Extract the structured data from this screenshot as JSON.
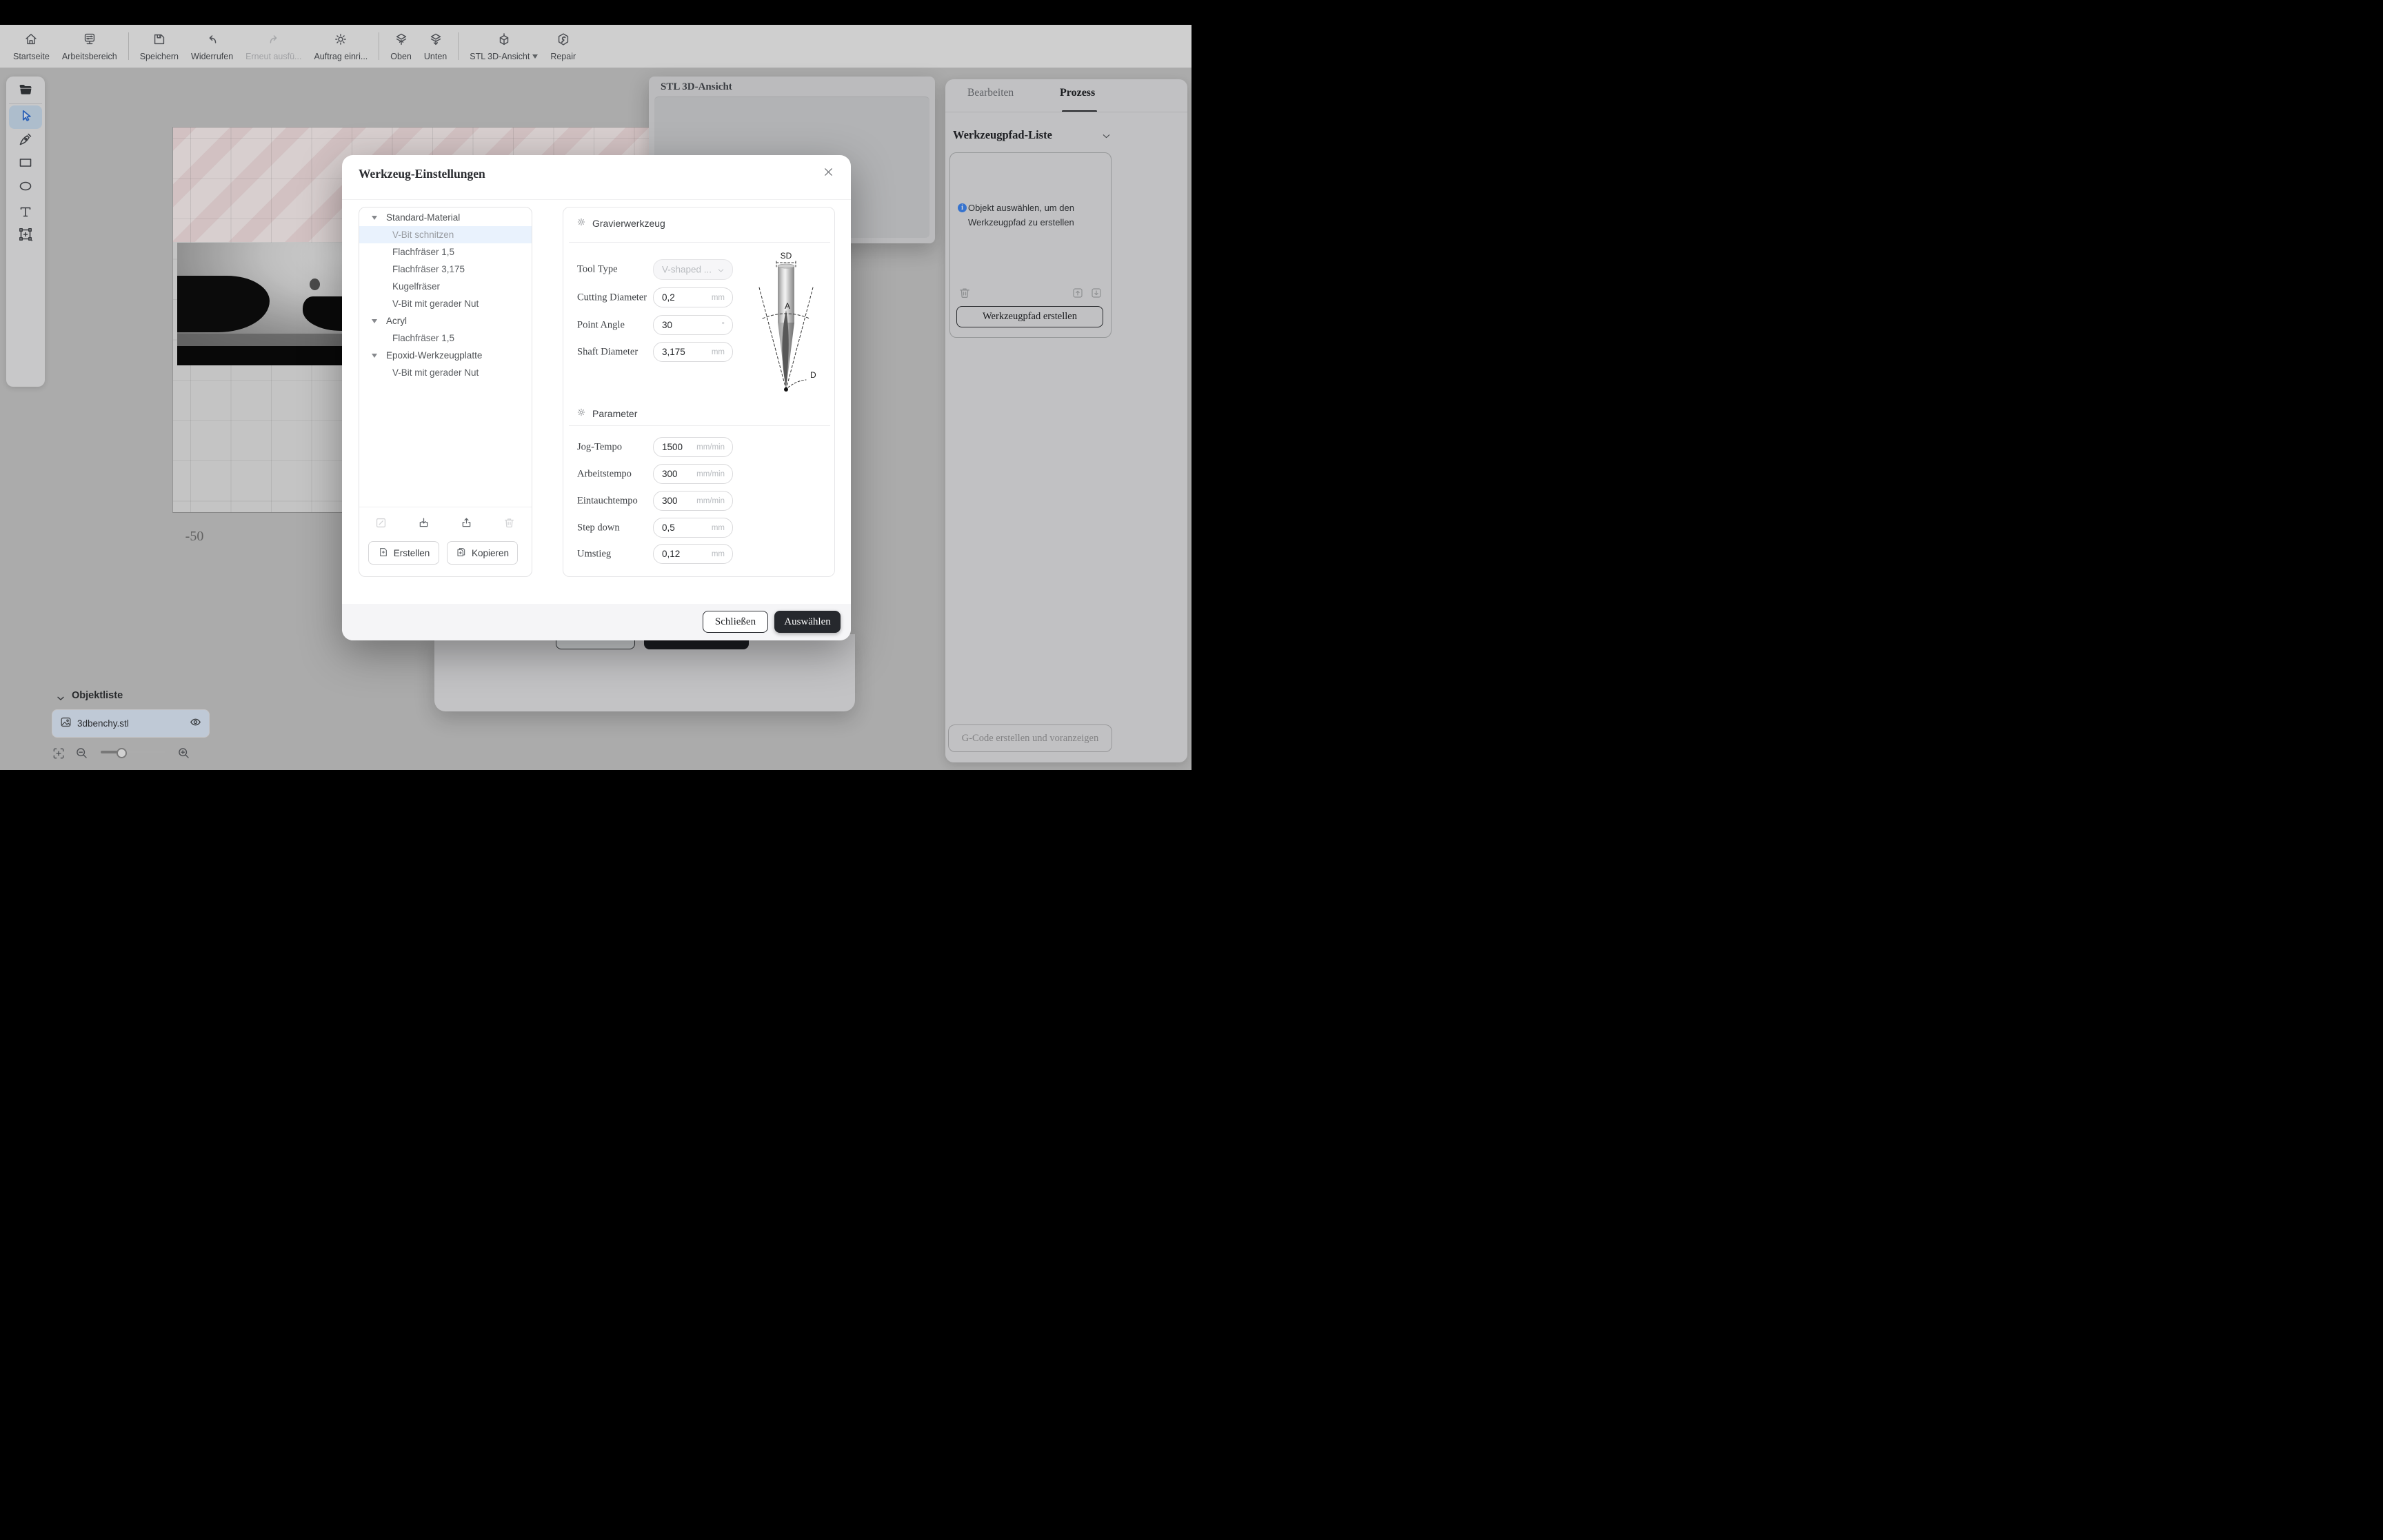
{
  "toolbar": {
    "items": [
      {
        "id": "startseite",
        "label": "Startseite"
      },
      {
        "id": "arbeitsbereich",
        "label": "Arbeitsbereich"
      },
      {
        "id": "speichern",
        "label": "Speichern"
      },
      {
        "id": "widerrufen",
        "label": "Widerrufen"
      },
      {
        "id": "erneut",
        "label": "Erneut ausfü...",
        "disabled": true
      },
      {
        "id": "auftrag",
        "label": "Auftrag einri..."
      },
      {
        "id": "oben",
        "label": "Oben"
      },
      {
        "id": "unten",
        "label": "Unten"
      },
      {
        "id": "stl3d",
        "label": "STL 3D-Ansicht",
        "has_dropdown": true
      },
      {
        "id": "repair",
        "label": "Repair"
      }
    ]
  },
  "canvas": {
    "axis_label": "-50"
  },
  "stl_panel": {
    "title": "STL 3D-Ansicht"
  },
  "modal": {
    "title": "Werkzeug-Einstellungen",
    "tree": {
      "groups": [
        {
          "label": "Standard-Material",
          "items": [
            {
              "label": "V-Bit schnitzen",
              "selected": true
            },
            {
              "label": "Flachfräser 1,5"
            },
            {
              "label": "Flachfräser 3,175"
            },
            {
              "label": "Kugelfräser"
            },
            {
              "label": "V-Bit mit gerader Nut"
            }
          ]
        },
        {
          "label": "Acryl",
          "items": [
            {
              "label": "Flachfräser 1,5"
            }
          ]
        },
        {
          "label": "Epoxid-Werkzeugplatte",
          "items": [
            {
              "label": "V-Bit mit gerader Nut"
            }
          ]
        }
      ]
    },
    "library_buttons": {
      "create": "Erstellen",
      "copy": "Kopieren"
    },
    "engrave_section": {
      "title": "Gravierwerkzeug",
      "fields": [
        {
          "label": "Tool Type",
          "value": "V-shaped ...",
          "type": "select"
        },
        {
          "label": "Cutting Diameter",
          "value": "0,2",
          "unit": "mm"
        },
        {
          "label": "Point Angle",
          "value": "30",
          "unit": "°"
        },
        {
          "label": "Shaft Diameter",
          "value": "3,175",
          "unit": "mm"
        }
      ]
    },
    "diagram": {
      "labels": {
        "shaft": "SD",
        "angle": "A",
        "diameter": "D"
      }
    },
    "param_section": {
      "title": "Parameter",
      "fields": [
        {
          "label": "Jog-Tempo",
          "value": "1500",
          "unit": "mm/min"
        },
        {
          "label": "Arbeitstempo",
          "value": "300",
          "unit": "mm/min"
        },
        {
          "label": "Eintauchtempo",
          "value": "300",
          "unit": "mm/min"
        },
        {
          "label": "Step down",
          "value": "0,5",
          "unit": "mm"
        },
        {
          "label": "Umstieg",
          "value": "0,12",
          "unit": "mm"
        }
      ]
    },
    "footer": {
      "close": "Schließen",
      "select": "Auswählen"
    }
  },
  "right_panel": {
    "tabs": [
      {
        "label": "Bearbeiten",
        "active": false
      },
      {
        "label": "Prozess",
        "active": true
      }
    ],
    "toolpath_list_title": "Werkzeugpfad-Liste",
    "empty_hint": "Objekt auswählen, um den Werkzeugpfad zu erstellen",
    "create_toolpath": "Werkzeugpfad erstellen",
    "gcode_button": "G-Code erstellen und voranzeigen"
  },
  "object_list": {
    "title": "Objektliste",
    "items": [
      {
        "name": "3dbenchy.stl",
        "visible": true
      }
    ]
  },
  "colors": {
    "accent_blue": "#3f7ad2",
    "info_blue": "#3f86f0",
    "dark_button": "#26282d",
    "selection_bg": "#e9f2fd"
  }
}
